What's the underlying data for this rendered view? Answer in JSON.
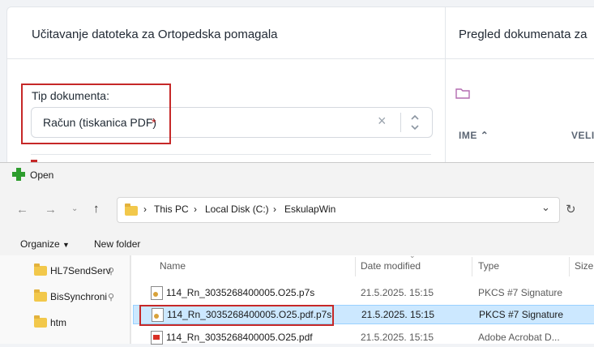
{
  "app": {
    "panel_left_title": "Učitavanje datoteka za Ortopedska pomagala",
    "panel_right_title": "Pregled dokumenata za",
    "doc_type_label": "Tip dokumenta:",
    "doc_type_value": "Račun (tiskanica PDF)",
    "required_mark": "*",
    "col_name": "IME",
    "col_size_partial": "VELI"
  },
  "dialog": {
    "title": "Open",
    "breadcrumbs": [
      "This PC",
      "Local Disk (C:)",
      "EskulapWin"
    ],
    "organize_label": "Organize",
    "new_folder_label": "New folder",
    "sidebar": [
      {
        "label": "HL7SendServ"
      },
      {
        "label": "BisSynchroni"
      },
      {
        "label": "htm"
      }
    ],
    "columns": {
      "name": "Name",
      "date": "Date modified",
      "type": "Type",
      "size": "Size"
    },
    "files": [
      {
        "name": "114_Rn_3035268400005.O25.p7s",
        "date": "21.5.2025. 15:15",
        "type": "PKCS #7 Signature"
      },
      {
        "name": "114_Rn_3035268400005.O25.pdf.p7s",
        "date": "21.5.2025. 15:15",
        "type": "PKCS #7 Signature"
      },
      {
        "name": "114_Rn_3035268400005.O25.pdf",
        "date": "21.5.2025. 15:15",
        "type": "Adobe Acrobat D..."
      }
    ]
  },
  "colors": {
    "highlight_red": "#c62828",
    "selected_row": "#cce8ff",
    "folder": "#f2c84b"
  }
}
